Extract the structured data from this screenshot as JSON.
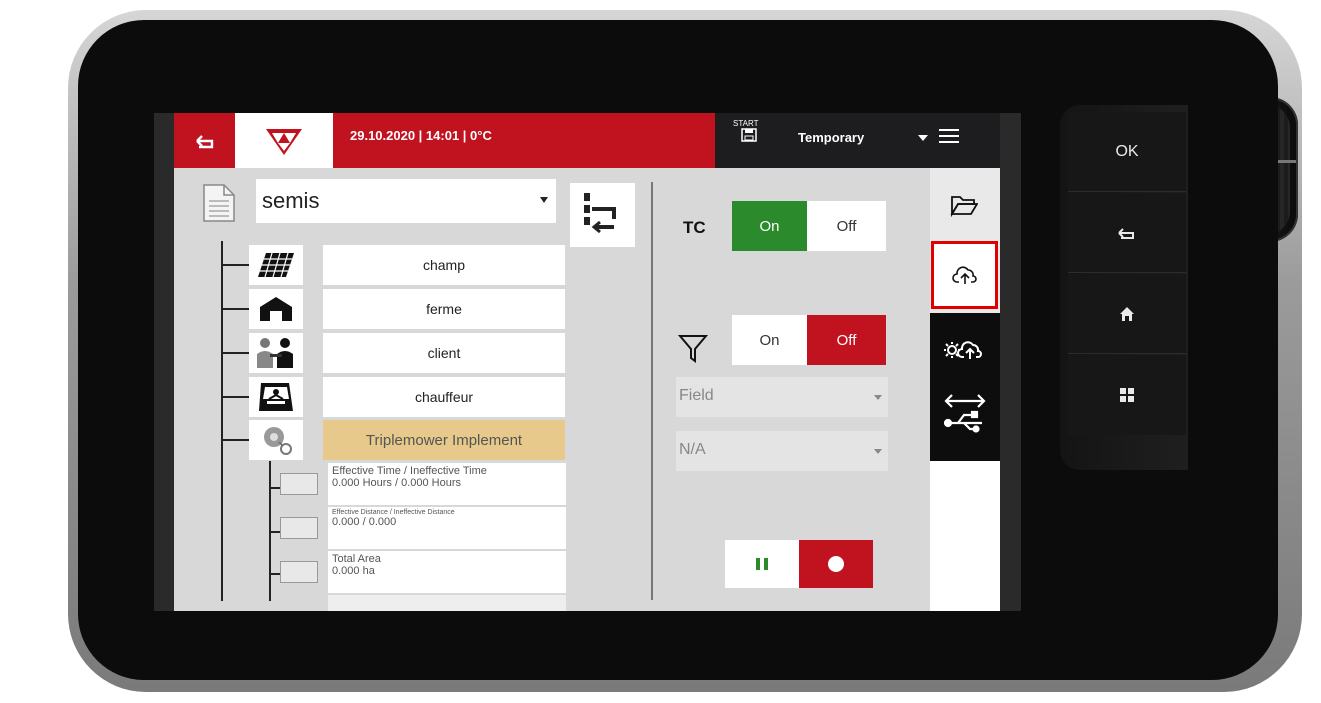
{
  "header": {
    "info": "29.10.2020 | 14:01 | 0°C",
    "start_label": "START",
    "profile": "Temporary"
  },
  "task": {
    "selected": "semis"
  },
  "tree": {
    "nodes": [
      {
        "label": "champ",
        "icon": "field-icon"
      },
      {
        "label": "ferme",
        "icon": "farm-icon"
      },
      {
        "label": "client",
        "icon": "client-icon"
      },
      {
        "label": "chauffeur",
        "icon": "driver-icon"
      },
      {
        "label": "Triplemower Implement",
        "icon": "implement-icon"
      }
    ],
    "metrics": [
      {
        "title": "Effective Time / Ineffective Time",
        "value": "0.000 Hours / 0.000 Hours"
      },
      {
        "title": "Effective Distance / Ineffective Distance",
        "value": "0.000 / 0.000"
      },
      {
        "title": "Total Area",
        "value": "0.000 ha"
      }
    ]
  },
  "controls": {
    "tc_label": "TC",
    "tc_on": "On",
    "tc_off": "Off",
    "filter_on": "On",
    "filter_off": "Off",
    "field_dropdown": "Field",
    "na_dropdown": "N/A"
  },
  "hardware_buttons": {
    "ok": "OK"
  },
  "colors": {
    "brand_red": "#c1121f",
    "active_green": "#2b8a2b",
    "highlight_border": "#e00000",
    "implement_tan": "#e6c98b"
  }
}
